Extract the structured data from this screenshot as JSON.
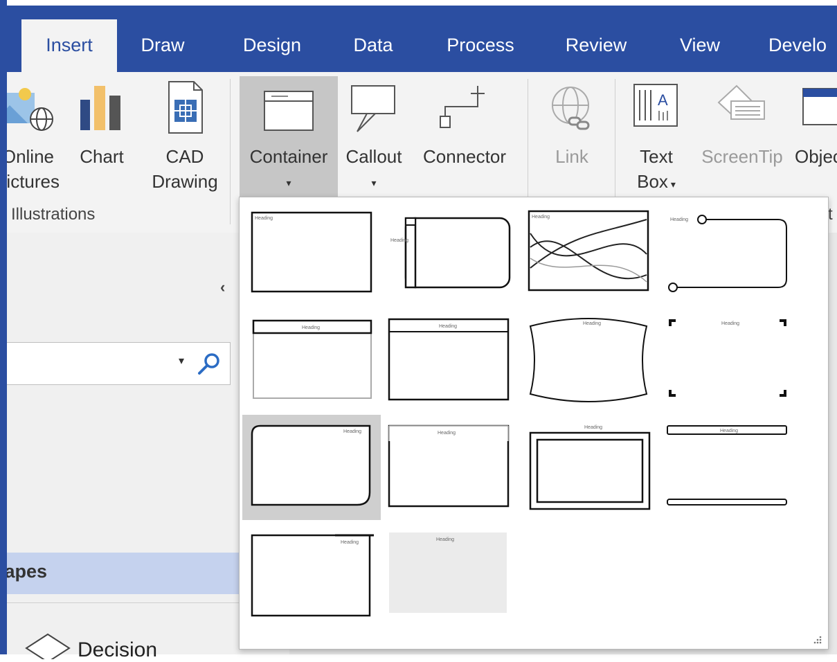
{
  "tabs": [
    {
      "label": "Insert",
      "active": true
    },
    {
      "label": "Draw"
    },
    {
      "label": "Design"
    },
    {
      "label": "Data"
    },
    {
      "label": "Process"
    },
    {
      "label": "Review"
    },
    {
      "label": "View"
    },
    {
      "label": "Develo"
    }
  ],
  "ribbon": {
    "online_pictures_line1": "Online",
    "online_pictures_line2": "Pictures",
    "chart": "Chart",
    "cad_line1": "CAD",
    "cad_line2": "Drawing",
    "container": "Container",
    "callout": "Callout",
    "connector": "Connector",
    "link": "Link",
    "textbox_line1": "Text",
    "textbox_line2": "Box",
    "screentip": "ScreenTip",
    "object": "Object",
    "group_illustrations": "Illustrations",
    "group_text_partial": "t"
  },
  "left_pane": {
    "shapes_title": "Shapes",
    "decision_label": "Decision"
  },
  "gallery": {
    "heading_text": "Heading",
    "selected_index": 8
  },
  "colors": {
    "accent": "#2b4ea1",
    "ribbon_bg": "#f3f3f3",
    "shapes_bar": "#c5d2ee"
  }
}
